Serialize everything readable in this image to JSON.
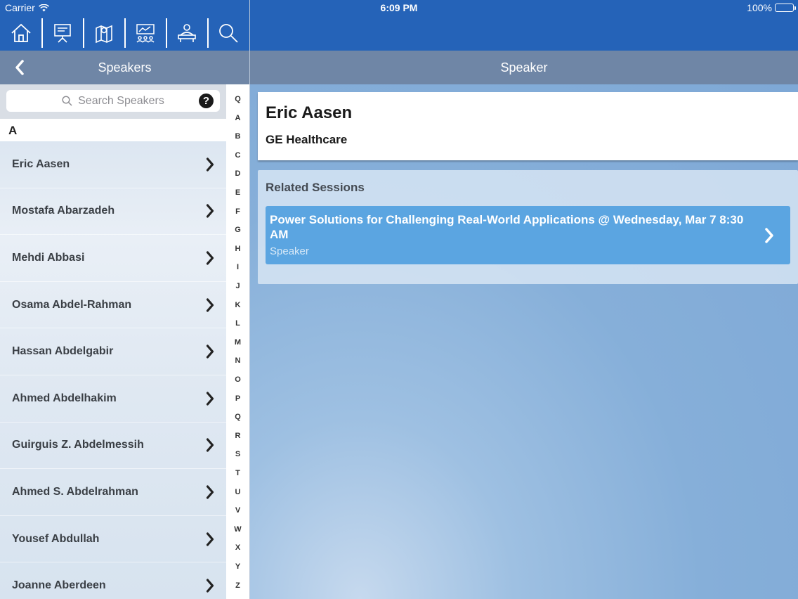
{
  "status": {
    "carrier": "Carrier",
    "time": "6:09 PM",
    "battery": "100%",
    "battery_level": 1.0
  },
  "toolbar": {
    "icons": [
      "home-icon",
      "presentation-board-icon",
      "map-icon",
      "exhibit-hall-icon",
      "attendee-icon",
      "search-icon"
    ]
  },
  "nav": {
    "left_title": "Speakers",
    "right_title": "Speaker"
  },
  "search": {
    "placeholder": "Search Speakers",
    "help": "?"
  },
  "list": {
    "section": "A",
    "speakers": [
      "Eric Aasen",
      "Mostafa Abarzadeh",
      "Mehdi Abbasi",
      "Osama Abdel-Rahman",
      "Hassan Abdelgabir",
      "Ahmed Abdelhakim",
      "Guirguis Z. Abdelmessih",
      "Ahmed S. Abdelrahman",
      "Yousef Abdullah",
      "Joanne Aberdeen"
    ]
  },
  "index": [
    "Q",
    "A",
    "B",
    "C",
    "D",
    "E",
    "F",
    "G",
    "H",
    "I",
    "J",
    "K",
    "L",
    "M",
    "N",
    "O",
    "P",
    "Q",
    "R",
    "S",
    "T",
    "U",
    "V",
    "W",
    "X",
    "Y",
    "Z"
  ],
  "detail": {
    "name": "Eric Aasen",
    "organization": "GE Healthcare",
    "related_title": "Related Sessions",
    "session": {
      "title": "Power Solutions for Challenging Real-World Applications @ Wednesday, Mar 7 8:30 AM",
      "role": "Speaker"
    }
  },
  "colors": {
    "topbar": "#2563b8",
    "navbar": "#6f86a6",
    "session_card": "#5ba5e1"
  }
}
